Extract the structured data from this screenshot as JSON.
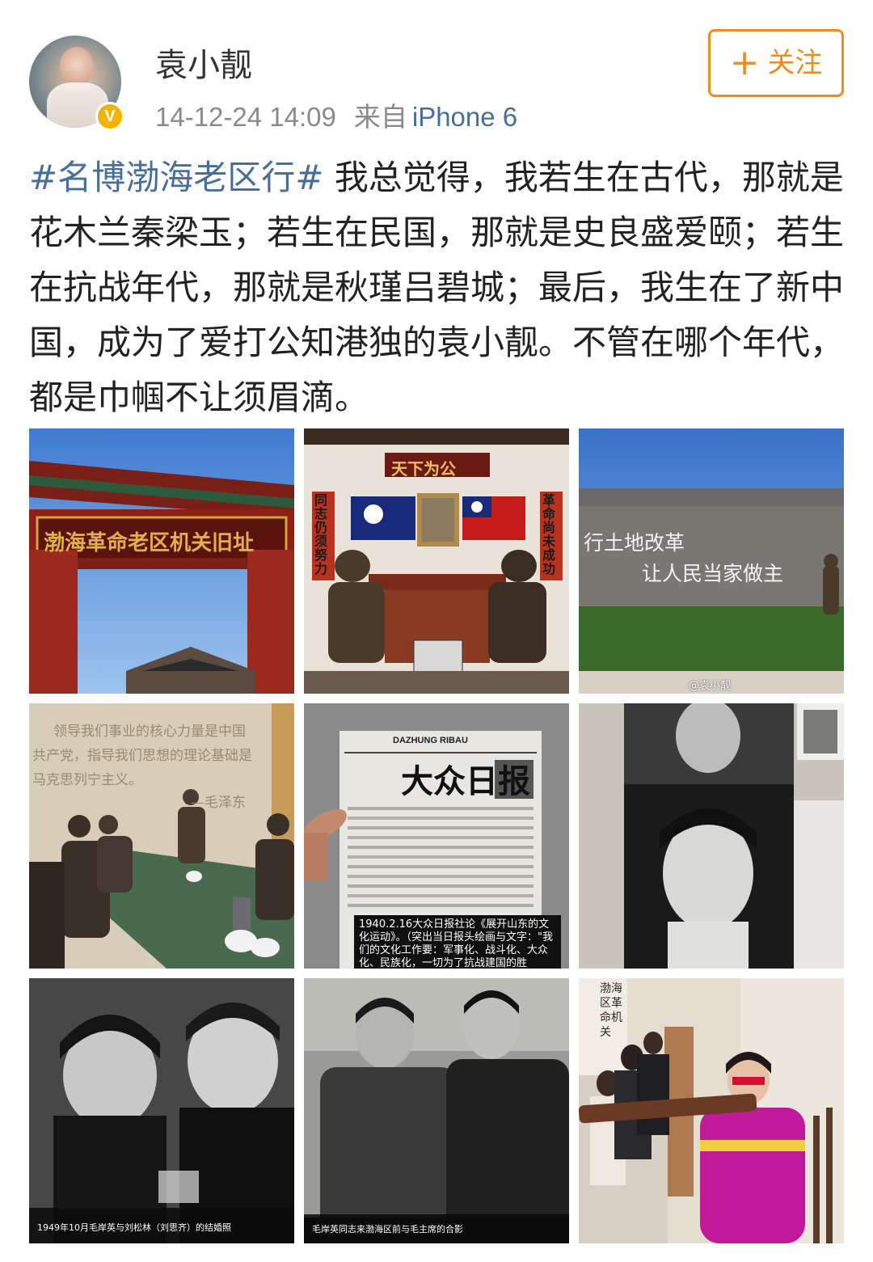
{
  "post": {
    "username": "袁小靓",
    "timestamp": "14-12-24 14:09",
    "from_label": "来自",
    "device": "iPhone 6",
    "follow_label": "关注",
    "follow_plus": "+",
    "verified_mark": "V",
    "hashtag": "#名博渤海老区行#",
    "body_text": "我总觉得，我若生在古代，那就是花木兰秦梁玉；若生在民国，那就是史良盛爱颐；若生在抗战年代，那就是秋瑾吕碧城；最后，我生在了新中国，成为了爱打公知港独的袁小靓。不管在哪个年代，都是巾帼不让须眉滴。"
  },
  "photos": {
    "p1_sign": "渤海革命老区机关旧址",
    "p2_plaque": "天下为公",
    "p2_left_couplet": "同志仍须努力",
    "p2_right_couplet": "革命尚未成功",
    "p3_wall_line1": "行土地改革",
    "p3_wall_line2": "让人民当家做主",
    "p3_watermark": "@袁小靓",
    "p4_wall_line1": "领导我们事业的核心力量是中国",
    "p4_wall_line2": "共产党，指导我们思想的理论基础是",
    "p4_wall_line3": "马克思列宁主义。",
    "p4_signature": "—毛泽东",
    "p5_masthead": "大众日报",
    "p5_pinyin": "DAZHUNG RIBAU",
    "p5_caption": "1940.2.16大众日报社论《展开山东的文化运动》。（突出当日报头绘画与文字：\"我们的文化工作要：军事化、战斗化、大众化、民族化，一切为了抗战建国的胜利。\"）",
    "p7_caption": "1949年10月毛岸英与刘松林（刘思齐）的结婚照",
    "p8_caption": "毛岸英同志来渤海区前与毛主席的合影",
    "p9_wall": "渤海区革命机关"
  },
  "colors": {
    "link_blue": "#466f9e",
    "follow_orange": "#f08c1e",
    "badge_yellow": "#f5b300"
  }
}
